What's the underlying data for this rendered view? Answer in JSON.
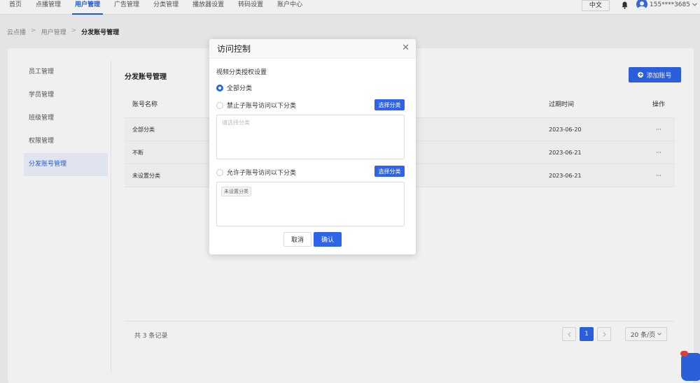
{
  "nav": {
    "items": [
      {
        "label": "首页",
        "active": false
      },
      {
        "label": "点播管理",
        "active": false
      },
      {
        "label": "用户管理",
        "active": true
      },
      {
        "label": "广告管理",
        "active": false
      },
      {
        "label": "分类管理",
        "active": false
      },
      {
        "label": "播放器设置",
        "active": false
      },
      {
        "label": "转码设置",
        "active": false
      },
      {
        "label": "账户中心",
        "active": false
      }
    ],
    "language": "中文",
    "user": "155****3685"
  },
  "breadcrumb": [
    "云点播",
    "用户管理",
    "分发账号管理"
  ],
  "sidebar": {
    "items": [
      {
        "label": "员工管理",
        "active": false
      },
      {
        "label": "学员管理",
        "active": false
      },
      {
        "label": "班级管理",
        "active": false
      },
      {
        "label": "权限管理",
        "active": false
      },
      {
        "label": "分发账号管理",
        "active": true
      }
    ]
  },
  "main": {
    "title": "分发账号管理",
    "add_button": "添加账号",
    "table": {
      "headers": [
        "账号名称",
        "过期时间",
        "操作"
      ],
      "rows": [
        {
          "name": "全部分类",
          "expire": "2023-06-20",
          "action": "···"
        },
        {
          "name": "不断",
          "expire": "2023-06-21",
          "action": "···"
        },
        {
          "name": "未设置分类",
          "expire": "2023-06-21",
          "action": "···"
        }
      ]
    },
    "footer": {
      "total": "共 3 条记录",
      "page": "1",
      "page_size": "20 条/页"
    }
  },
  "modal": {
    "title": "访问控制",
    "section_title": "视频分类授权设置",
    "option_all": "全部分类",
    "option_deny": "禁止子账号访问以下分类",
    "option_allow": "允许子账号访问以下分类",
    "select_button": "选择分类",
    "deny_placeholder": "请选择分类",
    "allow_tag": "未设置分类",
    "cancel": "取消",
    "confirm": "确认",
    "selected_option": "all"
  },
  "colors": {
    "accent": "#2e64e8"
  }
}
